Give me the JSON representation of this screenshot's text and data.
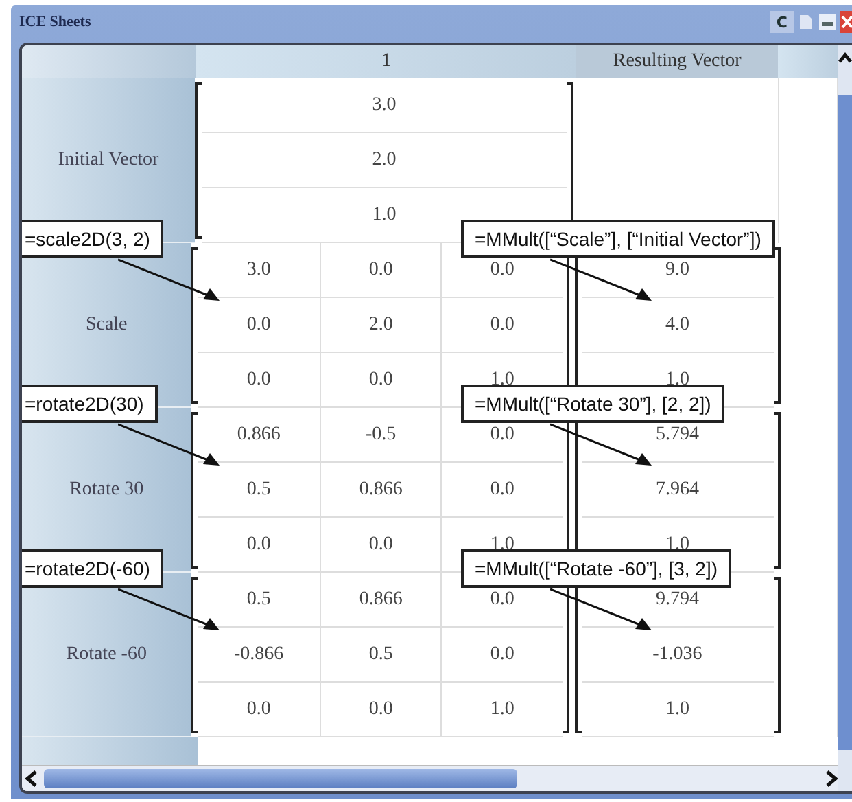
{
  "window": {
    "title": "ICE Sheets",
    "control_label": "C"
  },
  "columns": [
    "1",
    "Resulting Vector"
  ],
  "blocks": [
    {
      "label": "Initial Vector",
      "kind": "vector",
      "rows": [
        [
          "3.0"
        ],
        [
          "2.0"
        ],
        [
          "1.0"
        ]
      ]
    },
    {
      "label": "Scale",
      "kind": "matrix",
      "rows": [
        [
          "3.0",
          "0.0",
          "0.0"
        ],
        [
          "0.0",
          "2.0",
          "0.0"
        ],
        [
          "0.0",
          "0.0",
          "1.0"
        ]
      ],
      "result": [
        "9.0",
        "4.0",
        "1.0"
      ],
      "formula": "=scale2D(3, 2)",
      "result_formula": "=MMult([“Scale”], [“Initial Vector”])"
    },
    {
      "label": "Rotate 30",
      "kind": "matrix",
      "rows": [
        [
          "0.866",
          "-0.5",
          "0.0"
        ],
        [
          "0.5",
          "0.866",
          "0.0"
        ],
        [
          "0.0",
          "0.0",
          "1.0"
        ]
      ],
      "result": [
        "5.794",
        "7.964",
        "1.0"
      ],
      "formula": "=rotate2D(30)",
      "result_formula": "=MMult([“Rotate 30”], [2, 2])"
    },
    {
      "label": "Rotate -60",
      "kind": "matrix",
      "rows": [
        [
          "0.5",
          "0.866",
          "0.0"
        ],
        [
          "-0.866",
          "0.5",
          "0.0"
        ],
        [
          "0.0",
          "0.0",
          "1.0"
        ]
      ],
      "result": [
        "9.794",
        "-1.036",
        "1.0"
      ],
      "formula": "=rotate2D(-60)",
      "result_formula": "=MMult([“Rotate -60”], [3, 2])"
    }
  ]
}
